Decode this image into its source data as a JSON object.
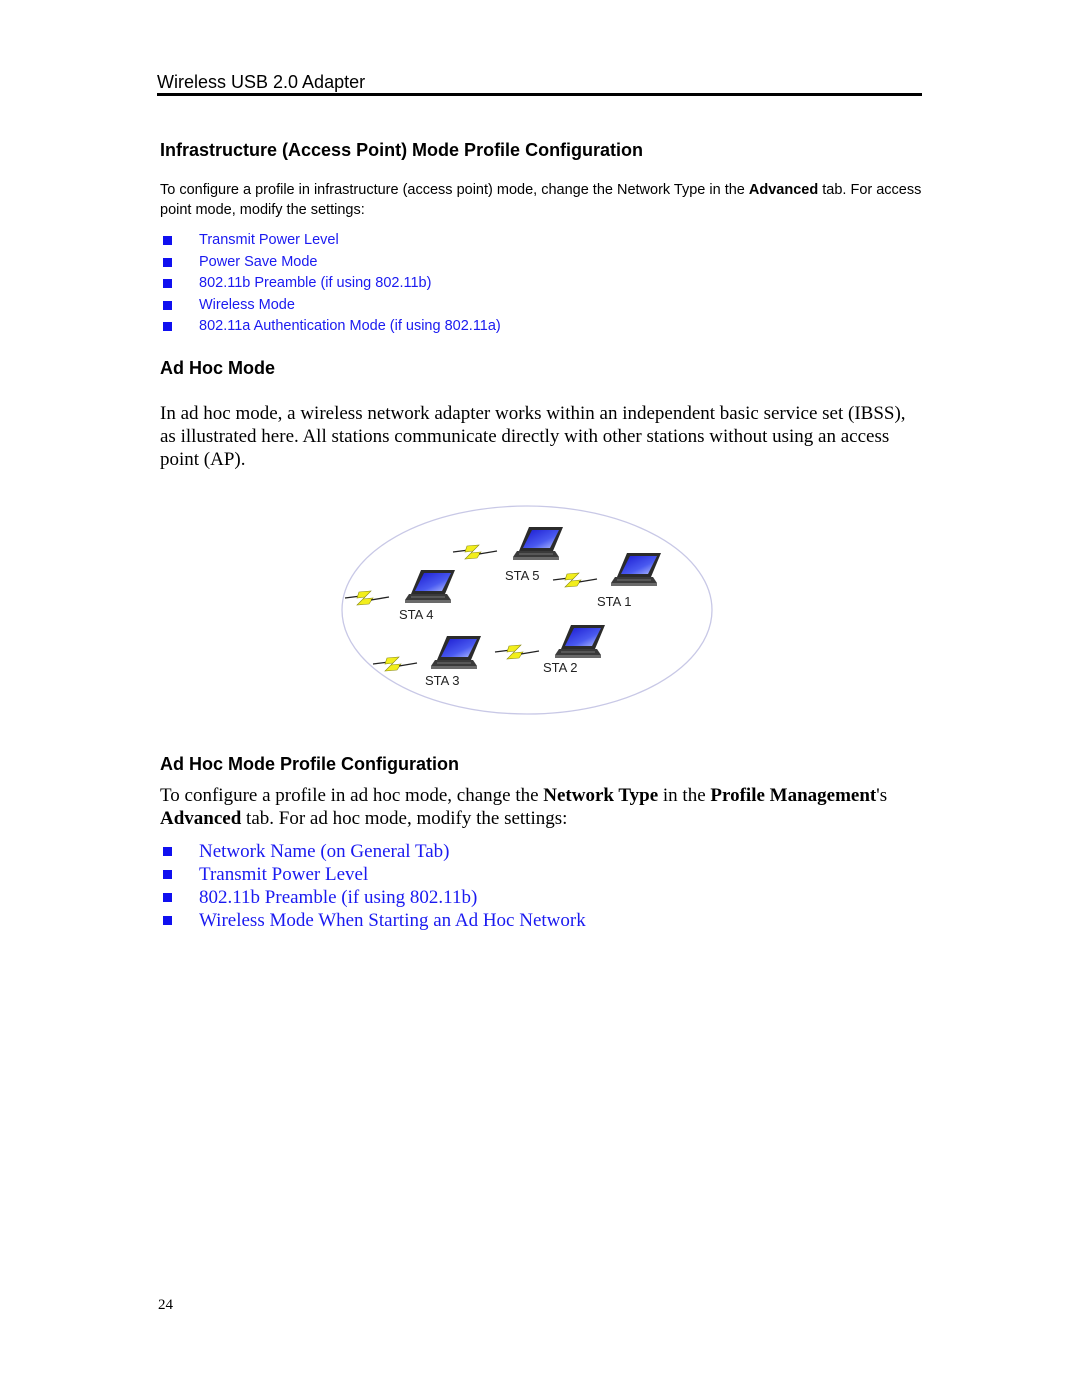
{
  "header": {
    "title": "Wireless USB 2.0 Adapter"
  },
  "sections": {
    "infrastructure": {
      "heading": "Infrastructure (Access Point) Mode Profile Configuration",
      "intro": {
        "part1": "To configure a profile in infrastructure (access point) mode, change the Network Type in the ",
        "bold1": "Advanced",
        "part2": " tab. For access point mode, modify the settings:"
      },
      "links": [
        "Transmit Power Level",
        "Power Save Mode",
        "802.11b Preamble (if using 802.11b)",
        "Wireless Mode",
        "802.11a Authentication Mode (if using 802.11a)"
      ]
    },
    "adhoc": {
      "heading": "Ad Hoc Mode",
      "body": "In ad hoc mode, a wireless network adapter works within an independent basic service set (IBSS), as illustrated here. All stations communicate directly with other stations without using an access point (AP)."
    },
    "adhoc_profile": {
      "heading": "Ad Hoc Mode Profile Configuration",
      "intro": {
        "part1": "To configure a profile in ad hoc mode, change the ",
        "bold1": "Network Type",
        "part2": " in the ",
        "bold2": "Profile Management",
        "part3": "'s ",
        "bold3": "Advanced",
        "part4": " tab. For ad hoc mode, modify the settings:"
      },
      "links": [
        "Network Name (on General Tab)",
        "Transmit Power Level",
        "802.11b Preamble (if using 802.11b)",
        "Wireless Mode When Starting an Ad Hoc Network"
      ]
    }
  },
  "diagram": {
    "description": "IBSS ad hoc network illustration",
    "stations": [
      "STA 5",
      "STA 1",
      "STA 4",
      "STA 3",
      "STA 2"
    ],
    "colors": {
      "boundary": "#c8c8e6",
      "screen": "#2a2ae0",
      "body": "#333333",
      "signal": "#f0f020"
    }
  },
  "footer": {
    "page_number": "24"
  },
  "colors": {
    "link": "#1a1af0",
    "bullet": "#1010f0"
  }
}
